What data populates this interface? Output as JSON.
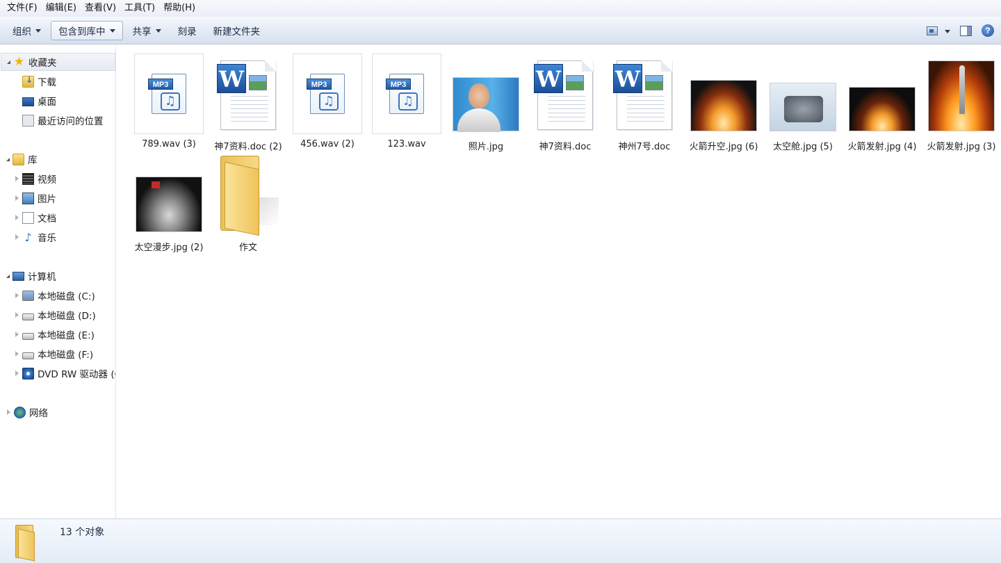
{
  "menu": [
    "文件(F)",
    "编辑(E)",
    "查看(V)",
    "工具(T)",
    "帮助(H)"
  ],
  "toolbar": {
    "organize": "组织",
    "include_library": "包含到库中",
    "share": "共享",
    "burn": "刻录",
    "new_folder": "新建文件夹"
  },
  "nav": {
    "favorites": "收藏夹",
    "downloads": "下载",
    "desktop": "桌面",
    "recent": "最近访问的位置",
    "libraries": "库",
    "videos": "视频",
    "pictures": "图片",
    "documents": "文档",
    "music": "音乐",
    "computer": "计算机",
    "drive_c": "本地磁盘 (C:)",
    "drive_d": "本地磁盘 (D:)",
    "drive_e": "本地磁盘 (E:)",
    "drive_f": "本地磁盘 (F:)",
    "dvd": "DVD RW 驱动器 (G",
    "network": "网络"
  },
  "files": [
    {
      "name": "789.wav (3)",
      "kind": "wav"
    },
    {
      "name": "神7资料.doc (2)",
      "kind": "doc"
    },
    {
      "name": "456.wav (2)",
      "kind": "wav"
    },
    {
      "name": "123.wav",
      "kind": "wav"
    },
    {
      "name": "照片.jpg",
      "kind": "jpg-portrait"
    },
    {
      "name": "神7资料.doc",
      "kind": "doc"
    },
    {
      "name": "神州7号.doc",
      "kind": "doc"
    },
    {
      "name": "火箭升空.jpg (6)",
      "kind": "jpg-launch"
    },
    {
      "name": "太空舱.jpg (5)",
      "kind": "jpg-capsule"
    },
    {
      "name": "火箭发射.jpg (4)",
      "kind": "jpg-launch"
    },
    {
      "name": "火箭发射.jpg (3)",
      "kind": "jpg-rocket"
    },
    {
      "name": "太空漫步.jpg (2)",
      "kind": "jpg-spacewalk"
    },
    {
      "name": "作文",
      "kind": "folder"
    }
  ],
  "icons": {
    "mp3_badge": "MP3",
    "word_letter": "W",
    "help": "?"
  },
  "status": {
    "count": "13 个对象"
  }
}
